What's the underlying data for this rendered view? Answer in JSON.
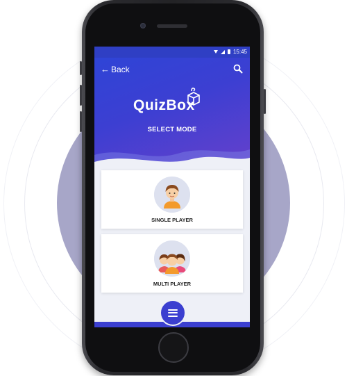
{
  "statusbar": {
    "time": "15:45"
  },
  "header": {
    "back_label": "Back",
    "arrow": "←",
    "title": "SELECT MODE"
  },
  "logo": {
    "text": "QuizBox"
  },
  "modes": [
    {
      "label": "SINGLE PLAYER",
      "icon": "single-player-avatar"
    },
    {
      "label": "MULTI PLAYER",
      "icon": "multi-player-avatar"
    }
  ],
  "colors": {
    "primary": "#2f44d6",
    "accent": "#6340cc",
    "background": "#eef0f7",
    "disk": "#a7a6c8"
  }
}
